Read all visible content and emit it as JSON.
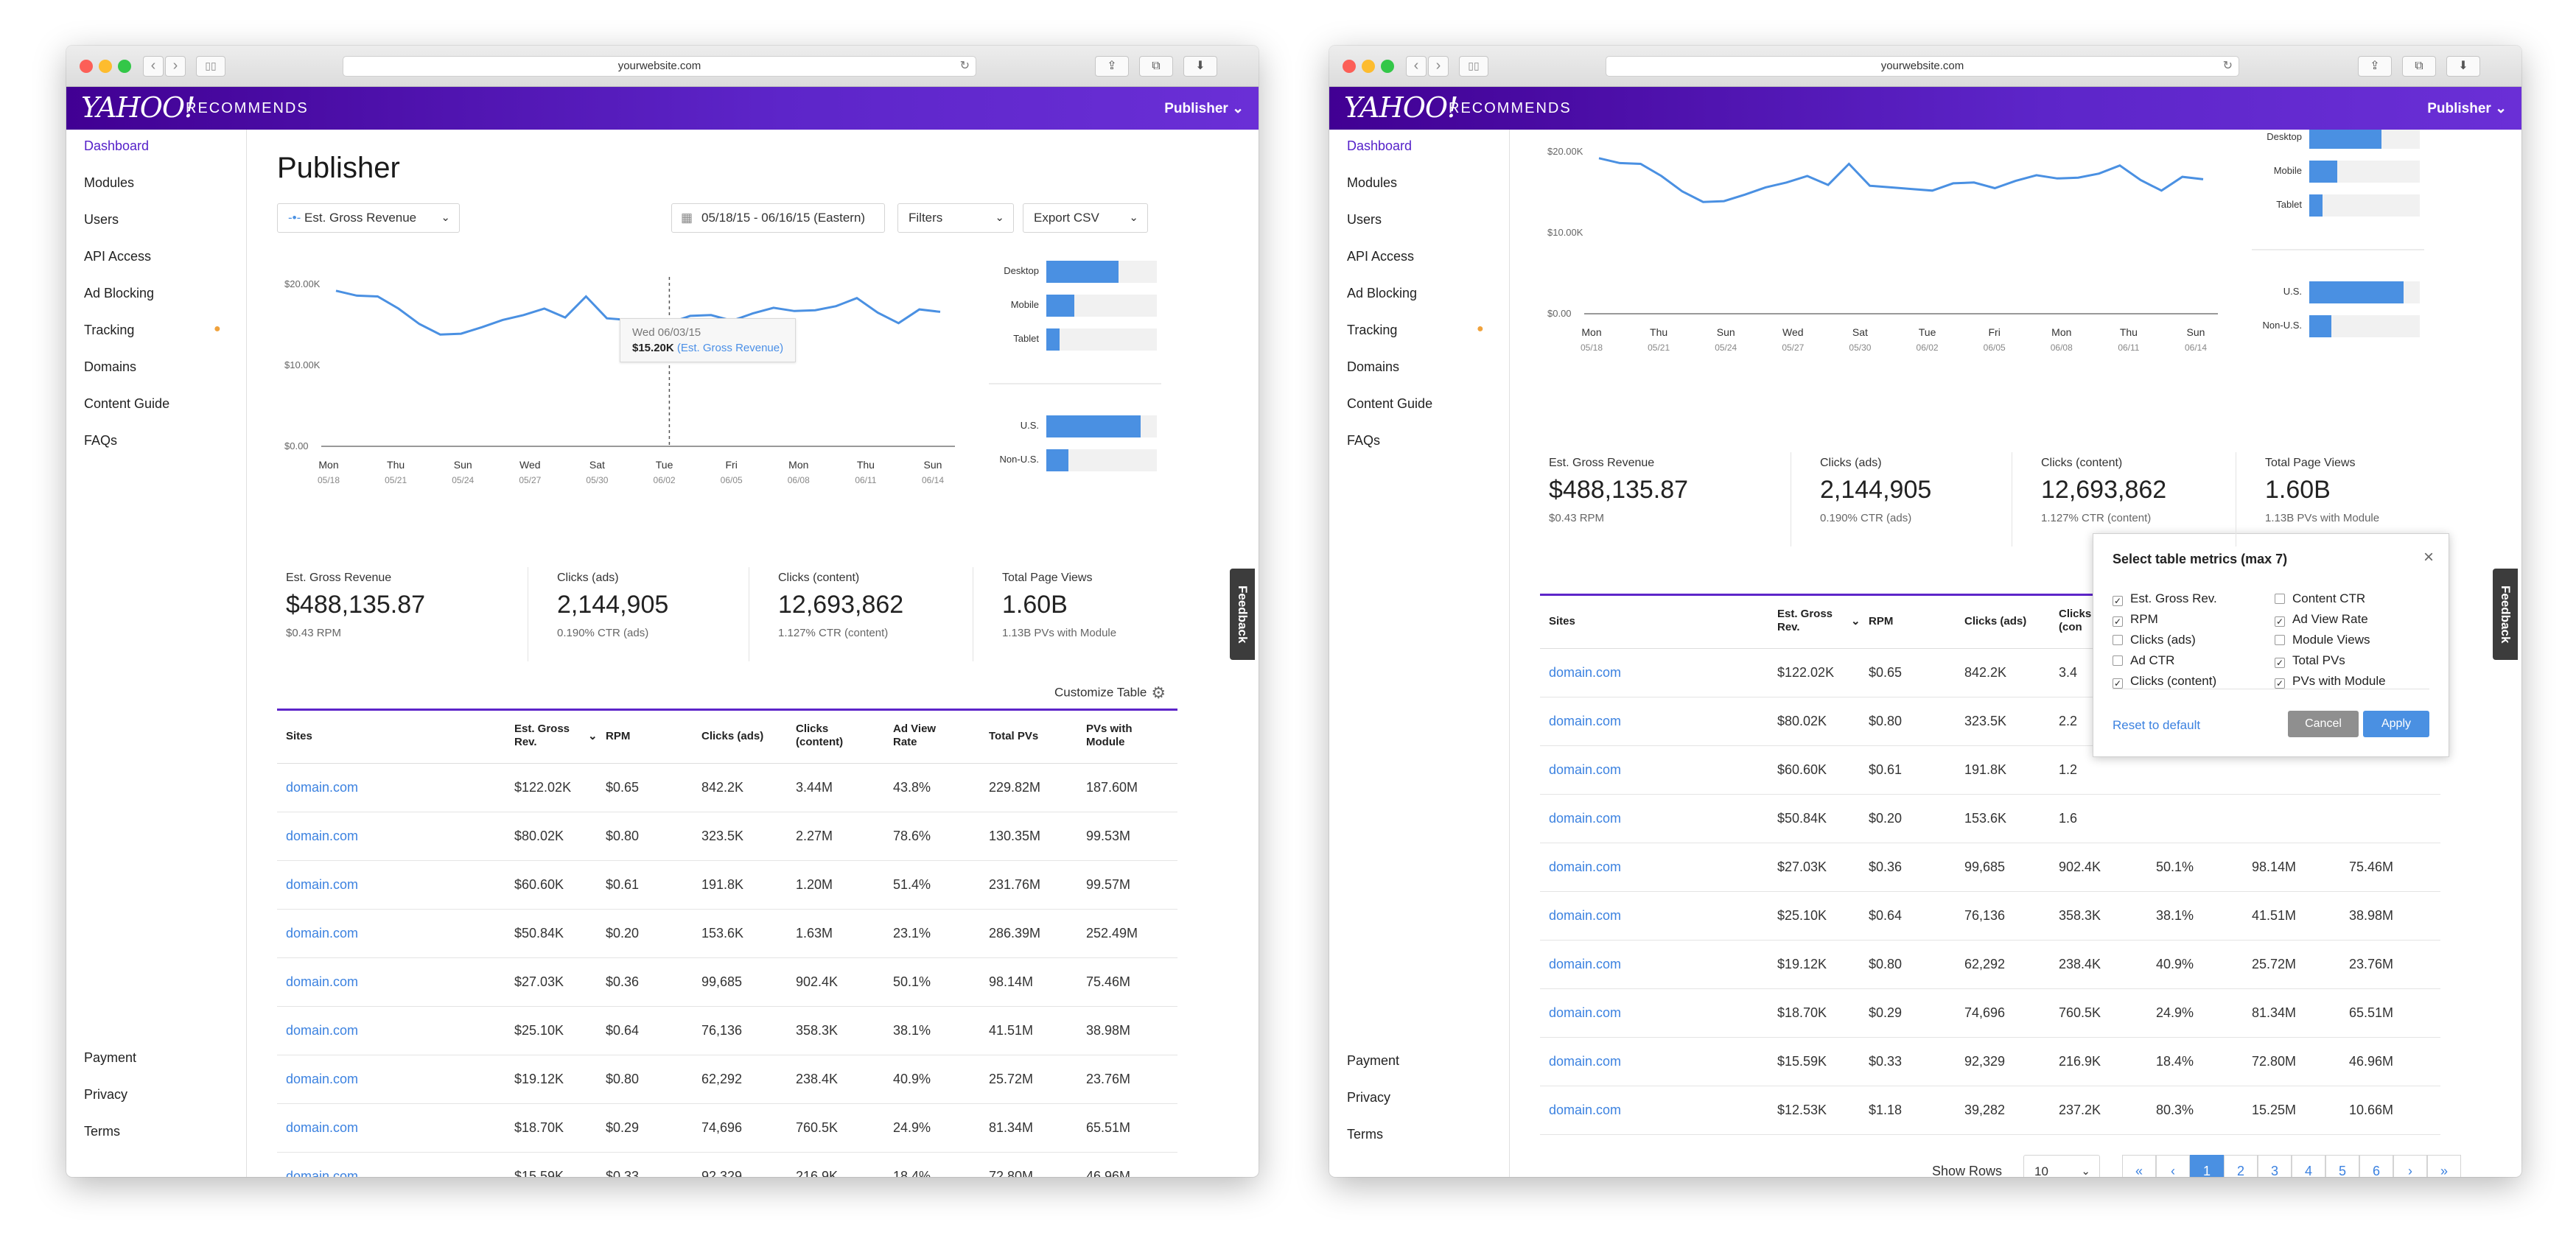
{
  "browser": {
    "url": "yourwebsite.com"
  },
  "brand": {
    "logo": "YAHOO!",
    "product": "RECOMMENDS",
    "account": "Publisher"
  },
  "sidebar": {
    "items": [
      "Dashboard",
      "Modules",
      "Users",
      "API Access",
      "Ad Blocking",
      "Tracking",
      "Domains",
      "Content Guide",
      "FAQs"
    ],
    "footer": [
      "Payment",
      "Privacy",
      "Terms"
    ]
  },
  "page": {
    "title": "Publisher",
    "metric_select": "Est. Gross Revenue",
    "date_range": "05/18/15 - 06/16/15 (Eastern)",
    "filters": "Filters",
    "export": "Export CSV",
    "feedback": "Feedback",
    "customize": "Customize Table"
  },
  "tooltip": {
    "date": "Wed 06/03/15",
    "value": "$15.20K",
    "series": "(Est. Gross Revenue)"
  },
  "chart_data": {
    "type": "line",
    "y_ticks": [
      "$20.00K",
      "$10.00K",
      "$0.00"
    ],
    "ylim": [
      0,
      20000
    ],
    "x_labels": [
      {
        "day": "Mon",
        "date": "05/18"
      },
      {
        "day": "Thu",
        "date": "05/21"
      },
      {
        "day": "Sun",
        "date": "05/24"
      },
      {
        "day": "Wed",
        "date": "05/27"
      },
      {
        "day": "Sat",
        "date": "05/30"
      },
      {
        "day": "Tue",
        "date": "06/02"
      },
      {
        "day": "Fri",
        "date": "06/05"
      },
      {
        "day": "Mon",
        "date": "06/08"
      },
      {
        "day": "Thu",
        "date": "06/11"
      },
      {
        "day": "Sun",
        "date": "06/14"
      }
    ],
    "series": [
      {
        "values": [
          19200,
          18600,
          18500,
          17000,
          15100,
          13800,
          13900,
          14700,
          15600,
          16200,
          17000,
          15900,
          18500,
          15800,
          15600,
          15400,
          15200,
          16100,
          16200,
          15500,
          16400,
          17100,
          16700,
          16800,
          17300,
          18300,
          16500,
          15200,
          16900,
          16600
        ]
      }
    ],
    "devices": [
      {
        "label": "Desktop",
        "value": 0.65
      },
      {
        "label": "Mobile",
        "value": 0.25
      },
      {
        "label": "Tablet",
        "value": 0.12
      }
    ],
    "regions": [
      {
        "label": "U.S.",
        "value": 0.85
      },
      {
        "label": "Non-U.S.",
        "value": 0.2
      }
    ]
  },
  "stats": [
    {
      "title": "Est. Gross Revenue",
      "value": "$488,135.87",
      "sub": "$0.43 RPM"
    },
    {
      "title": "Clicks (ads)",
      "value": "2,144,905",
      "sub": "0.190% CTR (ads)"
    },
    {
      "title": "Clicks (content)",
      "value": "12,693,862",
      "sub": "1.127% CTR (content)"
    },
    {
      "title": "Total Page Views",
      "value": "1.60B",
      "sub": "1.13B PVs with Module"
    }
  ],
  "table": {
    "headers": [
      "Sites",
      "Est. Gross\nRev.",
      "RPM",
      "Clicks (ads)",
      "Clicks\n(content)",
      "Ad View\nRate",
      "Total PVs",
      "PVs with\nModule"
    ],
    "headers2": [
      "Sites",
      "Est. Gross\nRev.",
      "RPM",
      "Clicks (ads)",
      "Clicks\n(con",
      "",
      "",
      ""
    ],
    "rows": [
      [
        "domain.com",
        "$122.02K",
        "$0.65",
        "842.2K",
        "3.44M",
        "43.8%",
        "229.82M",
        "187.60M"
      ],
      [
        "domain.com",
        "$80.02K",
        "$0.80",
        "323.5K",
        "2.27M",
        "78.6%",
        "130.35M",
        "99.53M"
      ],
      [
        "domain.com",
        "$60.60K",
        "$0.61",
        "191.8K",
        "1.20M",
        "51.4%",
        "231.76M",
        "99.57M"
      ],
      [
        "domain.com",
        "$50.84K",
        "$0.20",
        "153.6K",
        "1.63M",
        "23.1%",
        "286.39M",
        "252.49M"
      ],
      [
        "domain.com",
        "$27.03K",
        "$0.36",
        "99,685",
        "902.4K",
        "50.1%",
        "98.14M",
        "75.46M"
      ],
      [
        "domain.com",
        "$25.10K",
        "$0.64",
        "76,136",
        "358.3K",
        "38.1%",
        "41.51M",
        "38.98M"
      ],
      [
        "domain.com",
        "$19.12K",
        "$0.80",
        "62,292",
        "238.4K",
        "40.9%",
        "25.72M",
        "23.76M"
      ],
      [
        "domain.com",
        "$18.70K",
        "$0.29",
        "74,696",
        "760.5K",
        "24.9%",
        "81.34M",
        "65.51M"
      ],
      [
        "domain.com",
        "$15.59K",
        "$0.33",
        "92,329",
        "216.9K",
        "18.4%",
        "72.80M",
        "46.96M"
      ],
      [
        "domain.com",
        "$12.53K",
        "$1.18",
        "39,282",
        "237.2K",
        "80.3%",
        "15.25M",
        "10.66M"
      ]
    ],
    "rows2_partial": [
      "3.4",
      "2.2",
      "1.2",
      "1.6"
    ]
  },
  "modal": {
    "title": "Select table metrics (max 7)",
    "close": "×",
    "left": [
      {
        "label": "Est. Gross Rev.",
        "checked": "✓"
      },
      {
        "label": "RPM",
        "checked": "✓"
      },
      {
        "label": "Clicks (ads)",
        "checked": ""
      },
      {
        "label": "Ad CTR",
        "checked": ""
      },
      {
        "label": "Clicks (content)",
        "checked": "✓"
      }
    ],
    "right": [
      {
        "label": "Content CTR",
        "checked": ""
      },
      {
        "label": "Ad View Rate",
        "checked": "✓"
      },
      {
        "label": "Module Views",
        "checked": ""
      },
      {
        "label": "Total PVs",
        "checked": "✓"
      },
      {
        "label": "PVs with Module",
        "checked": "✓"
      }
    ],
    "reset": "Reset to default",
    "cancel": "Cancel",
    "apply": "Apply"
  },
  "pager": {
    "label": "Show Rows",
    "rows": "10",
    "pages": [
      "«",
      "‹",
      "1",
      "2",
      "3",
      "4",
      "5",
      "6",
      "›",
      "»"
    ]
  },
  "colors": {
    "accent": "#5d25c9",
    "bar": "#4a90e2",
    "link": "#3c82e0"
  }
}
